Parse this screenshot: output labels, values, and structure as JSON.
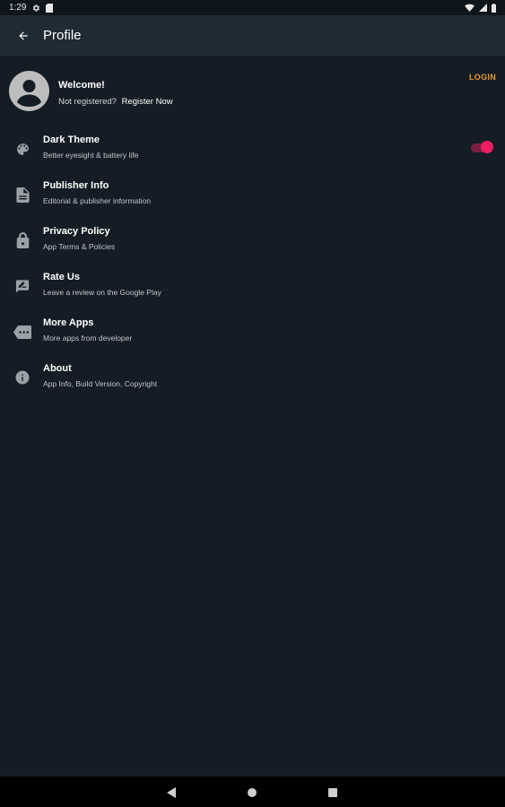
{
  "status_bar": {
    "time": "1:29",
    "icons": [
      "settings-icon",
      "sd-card-icon",
      "wifi-icon",
      "signal-icon",
      "battery-icon"
    ]
  },
  "app_bar": {
    "back_icon": "arrow-back-icon",
    "title": "Profile"
  },
  "profile": {
    "avatar_icon": "account-circle-icon",
    "welcome": "Welcome!",
    "not_registered": "Not registered?",
    "register_link": "Register Now",
    "login_label": "LOGIN"
  },
  "menu": {
    "items": [
      {
        "icon": "palette-icon",
        "title": "Dark Theme",
        "subtitle": "Better eyesight & battery life",
        "toggle_on": true
      },
      {
        "icon": "document-icon",
        "title": "Publisher Info",
        "subtitle": "Editorial & publisher information"
      },
      {
        "icon": "lock-icon",
        "title": "Privacy Policy",
        "subtitle": "App Terms & Policies"
      },
      {
        "icon": "rate-review-icon",
        "title": "Rate Us",
        "subtitle": "Leave a review on the Google Play"
      },
      {
        "icon": "more-apps-icon",
        "title": "More Apps",
        "subtitle": "More apps from developer"
      },
      {
        "icon": "info-icon",
        "title": "About",
        "subtitle": "App Info, Build Version, Copyright"
      }
    ]
  },
  "nav_bar": {
    "buttons": [
      "nav-back-icon",
      "nav-home-icon",
      "nav-recents-icon"
    ]
  },
  "colors": {
    "background": "#141d25",
    "app_bar": "#1f2a33",
    "accent_login": "#e8962f",
    "toggle_accent": "#ec1e63"
  }
}
